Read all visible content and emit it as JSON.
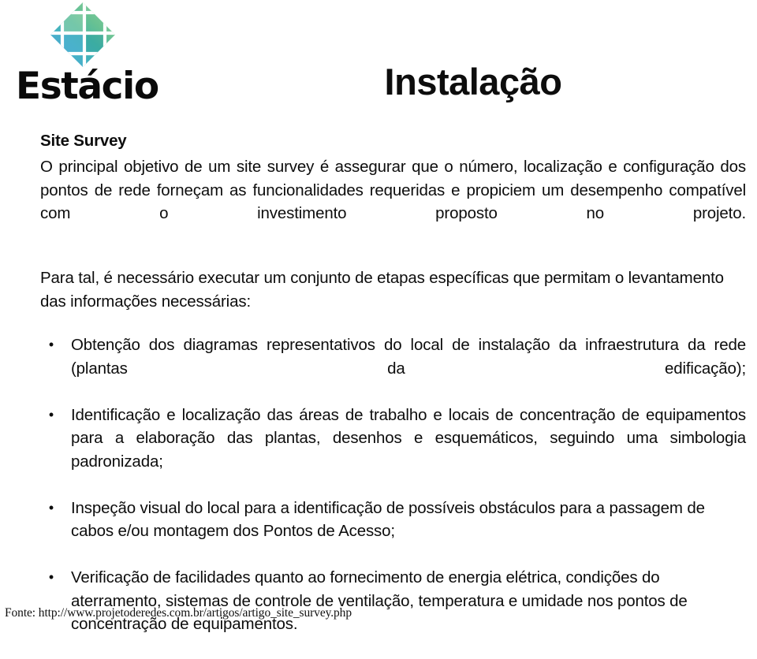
{
  "slide": {
    "title": "Instalação",
    "background_color": "#ffffff",
    "text_color": "#0d0d0d"
  },
  "brand": {
    "name": "Estácio",
    "logo_icon": "estacio-diamond-grid-logo",
    "colors": {
      "green_light": "#9ad6ab",
      "green": "#6ec394",
      "green_mid": "#5bbd93",
      "teal": "#3aa9a4",
      "teal_dark": "#2f9f9c",
      "blue": "#4fb0d4",
      "blue_dark": "#3f9fc6"
    }
  },
  "content": {
    "section_heading": "Site Survey",
    "paragraph_1": "O principal objetivo de um site survey é assegurar que o número, localização e configuração dos pontos de rede forneçam as funcionalidades requeridas e propiciem um desempenho compatível com o investimento proposto no projeto.",
    "paragraph_2": "Para tal, é necessário executar um conjunto de etapas específicas que permitam o levantamento das informações necessárias:",
    "bullet_marker": "•",
    "bullets": [
      "Obtenção dos diagramas representativos do local de instalação da infraestrutura da rede (plantas da edificação);",
      "Identificação e localização das áreas de trabalho e locais de concentração de equipamentos para a elaboração das plantas, desenhos e esquemáticos, seguindo uma simbologia padronizada;",
      "Inspeção visual do local para a identificação de possíveis obstáculos para a passagem de cabos e/ou montagem dos Pontos de Acesso;",
      "Verificação de facilidades quanto ao fornecimento de energia elétrica, condições do aterramento, sistemas de controle de ventilação, temperatura e umidade nos pontos de concentração de equipamentos."
    ]
  },
  "footer": {
    "source": "Fonte: http://www.projetoderedes.com.br/artigos/artigo_site_survey.php"
  }
}
